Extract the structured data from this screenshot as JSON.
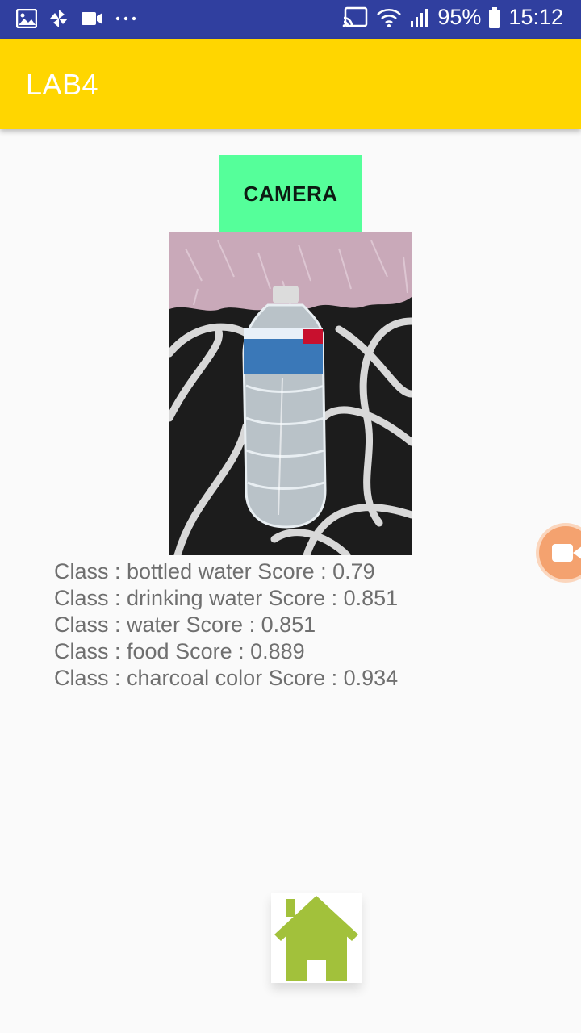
{
  "status_bar": {
    "battery": "95%",
    "time": "15:12",
    "left_icons": [
      "gallery-icon",
      "pinwheel-icon",
      "video-icon",
      "more-icon"
    ],
    "right_icons": [
      "cast-icon",
      "wifi-icon",
      "signal-icon",
      "battery-icon"
    ]
  },
  "app_bar": {
    "title": "LAB4",
    "color": "#ffd600"
  },
  "camera_button": {
    "label": "CAMERA",
    "color": "#55ff9a"
  },
  "results": [
    "Class : bottled water Score : 0.79",
    "Class : drinking water Score : 0.851",
    "Class : water Score : 0.851",
    "Class : food Score : 0.889",
    "Class : charcoal color Score : 0.934"
  ],
  "floating_button": {
    "icon": "video-camera-icon"
  },
  "home_button": {
    "icon": "home-icon",
    "color": "#a2c13b"
  }
}
